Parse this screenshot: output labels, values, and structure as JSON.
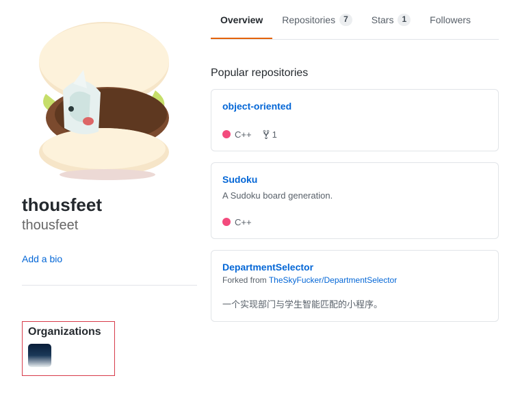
{
  "profile": {
    "display_name": "thousfeet",
    "username": "thousfeet",
    "add_bio_label": "Add a bio"
  },
  "orgs": {
    "heading": "Organizations"
  },
  "tabs": {
    "overview": "Overview",
    "repos_label": "Repositories",
    "repos_count": "7",
    "stars_label": "Stars",
    "stars_count": "1",
    "followers": "Followers"
  },
  "section": {
    "popular": "Popular repositories"
  },
  "colors": {
    "cpp": "#f34b7d"
  },
  "repos": [
    {
      "name": "object-oriented",
      "description": "",
      "forked_from_text": "",
      "forked_from_link": "",
      "language": "C++",
      "forks": "1"
    },
    {
      "name": "Sudoku",
      "description": "A Sudoku board generation.",
      "forked_from_text": "",
      "forked_from_link": "",
      "language": "C++",
      "forks": ""
    },
    {
      "name": "DepartmentSelector",
      "description": "一个实现部门与学生智能匹配的小程序。",
      "forked_from_text": "Forked from ",
      "forked_from_link": "TheSkyFucker/DepartmentSelector",
      "language": "",
      "forks": ""
    }
  ]
}
